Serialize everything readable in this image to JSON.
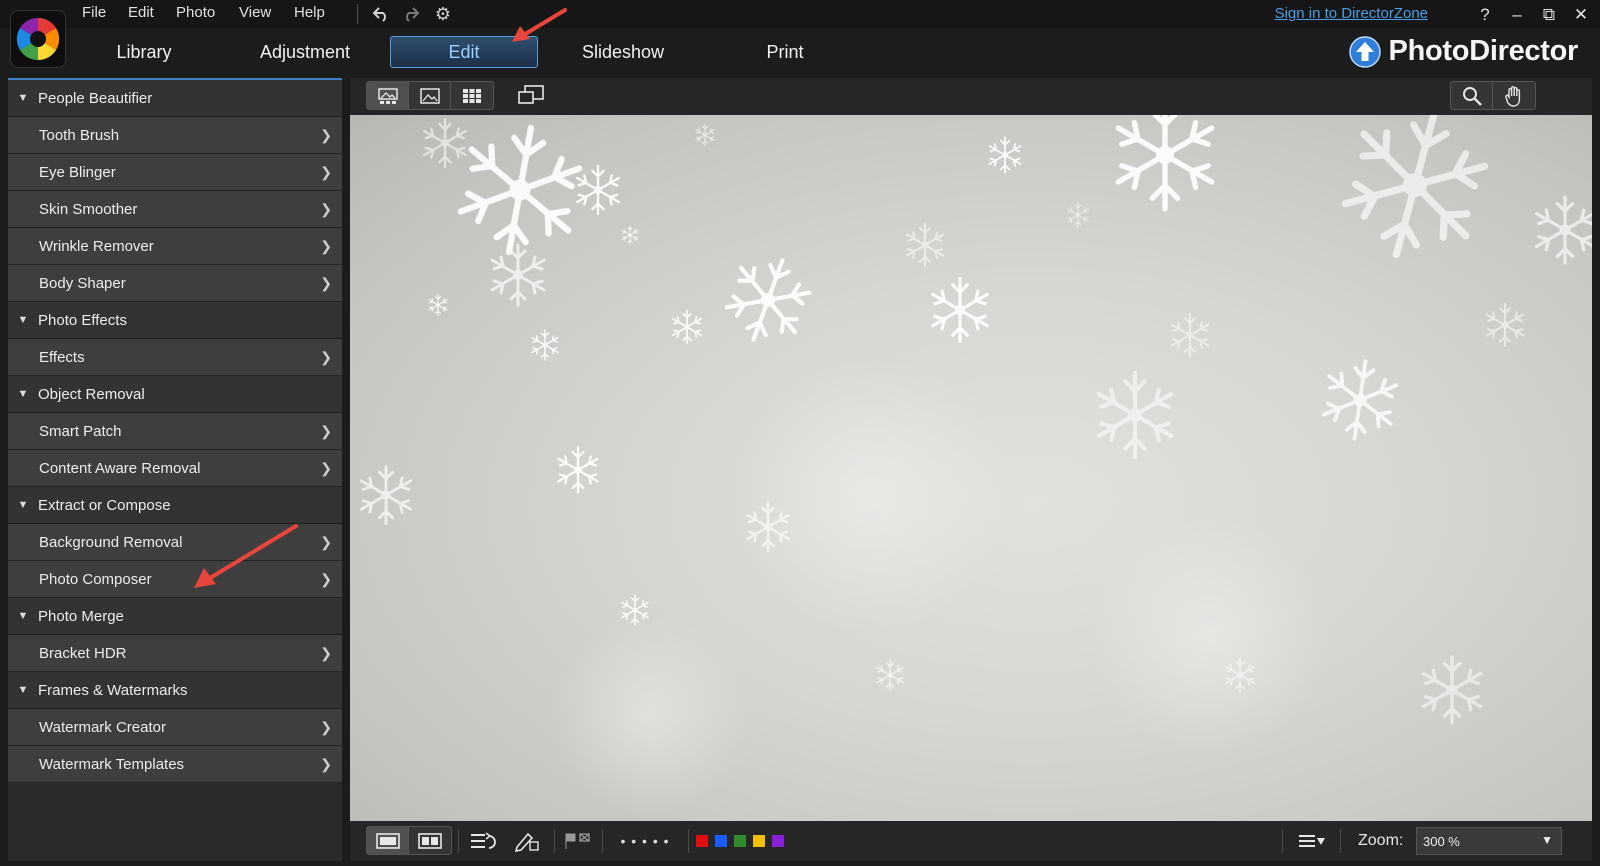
{
  "menu": [
    "File",
    "Edit",
    "Photo",
    "View",
    "Help"
  ],
  "toolbar_icons": [
    "undo-icon",
    "redo-icon",
    "gear-icon"
  ],
  "signin": "Sign in to DirectorZone",
  "window_buttons": [
    "?",
    "–",
    "⧉",
    "✕"
  ],
  "modes": [
    "Library",
    "Adjustment",
    "Edit",
    "Slideshow",
    "Print"
  ],
  "active_mode": "Edit",
  "brand": "PhotoDirector",
  "panel": {
    "sections": [
      {
        "title": "People Beautifier",
        "items": [
          "Tooth Brush",
          "Eye Blinger",
          "Skin Smoother",
          "Wrinkle Remover",
          "Body Shaper"
        ]
      },
      {
        "title": "Photo Effects",
        "items": [
          "Effects"
        ]
      },
      {
        "title": "Object Removal",
        "items": [
          "Smart Patch",
          "Content Aware Removal"
        ]
      },
      {
        "title": "Extract or Compose",
        "items": [
          "Background Removal",
          "Photo Composer"
        ]
      },
      {
        "title": "Photo Merge",
        "items": [
          "Bracket HDR"
        ]
      },
      {
        "title": "Frames & Watermarks",
        "items": [
          "Watermark Creator",
          "Watermark Templates"
        ]
      }
    ]
  },
  "viewer": {
    "rating_dots": "• • • • •",
    "color_labels": [
      "#e01010",
      "#1a5cff",
      "#2f8a2f",
      "#f0c000",
      "#8a20d8"
    ],
    "zoom_label": "Zoom:",
    "zoom_value": "300 %"
  },
  "colors": {
    "accent": "#3f7fc4",
    "signin": "#4a9fe6",
    "annotation": "#e8453c"
  }
}
